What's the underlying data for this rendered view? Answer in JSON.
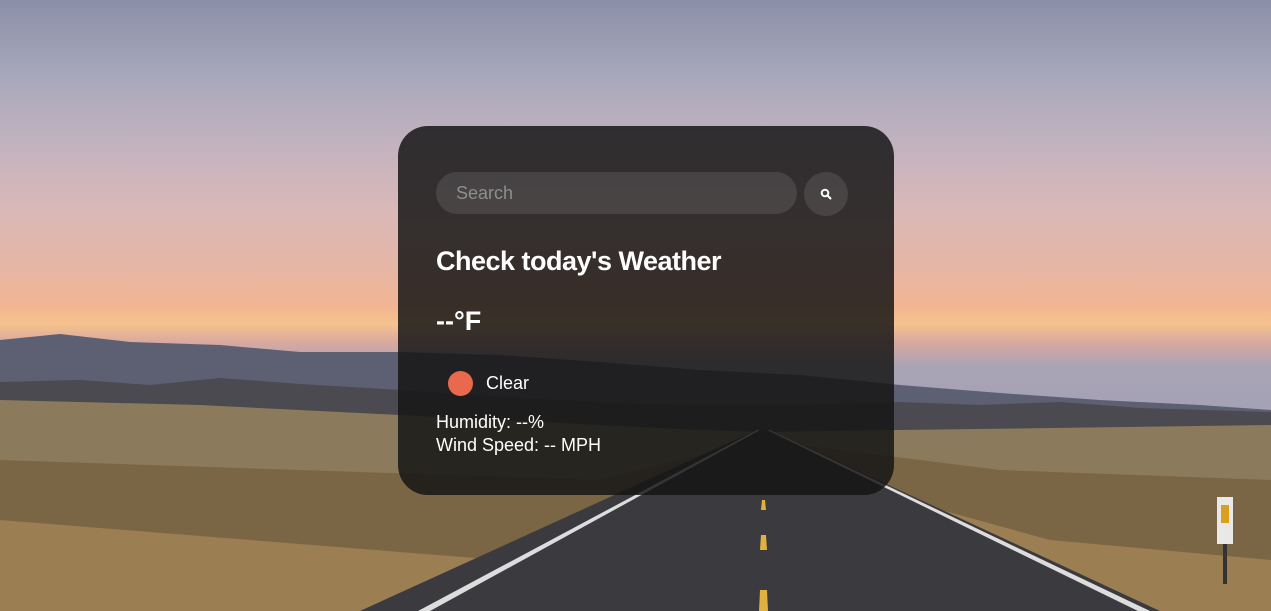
{
  "search": {
    "placeholder": "Search",
    "value": "",
    "button_icon": "search-icon"
  },
  "weather": {
    "heading": "Check today's Weather",
    "temperature": "--°F",
    "condition_icon": "weather-condition-icon",
    "condition_icon_color": "#e8694b",
    "condition": "Clear",
    "humidity": "Humidity: --%",
    "wind_speed": "Wind Speed: -- MPH"
  }
}
